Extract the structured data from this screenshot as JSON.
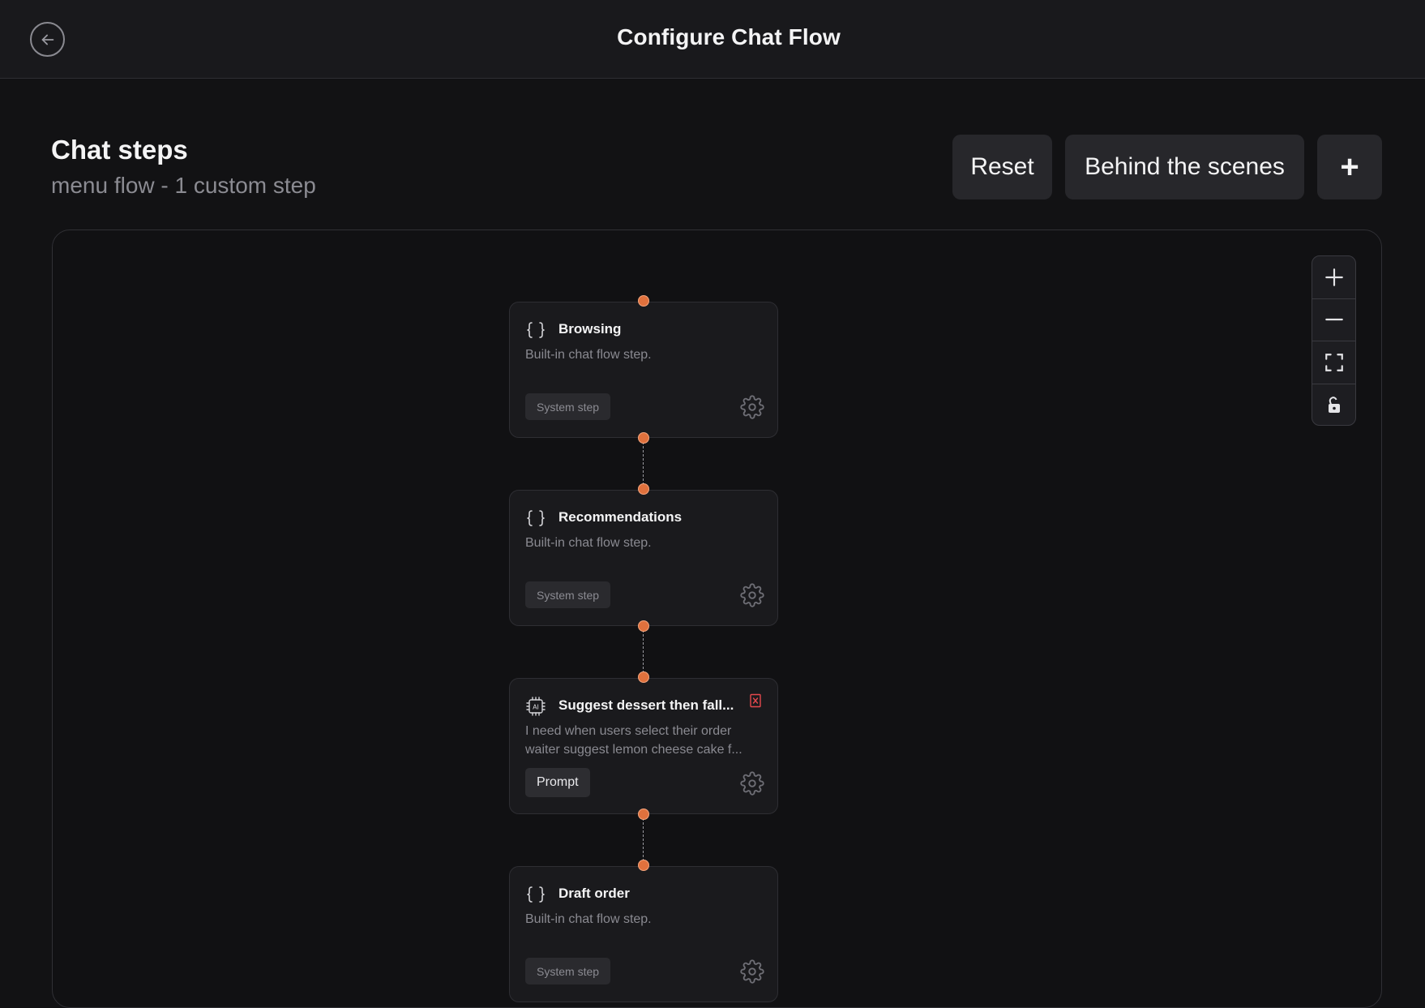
{
  "header": {
    "title": "Configure Chat Flow"
  },
  "section": {
    "title": "Chat steps",
    "subtitle": "menu flow - 1 custom step"
  },
  "actions": {
    "reset_label": "Reset",
    "behind_label": "Behind the scenes",
    "add_label": "+"
  },
  "nodes": [
    {
      "title": "Browsing",
      "description": "Built-in chat flow step.",
      "badge": "System step",
      "icon": "braces-icon"
    },
    {
      "title": "Recommendations",
      "description": "Built-in chat flow step.",
      "badge": "System step",
      "icon": "braces-icon"
    },
    {
      "title": "Suggest dessert then fall...",
      "description": "I need when users select their order waiter suggest lemon cheese cake f...",
      "badge": "Prompt",
      "icon": "ai-chip-icon"
    },
    {
      "title": "Draft order",
      "description": "Built-in chat flow step.",
      "badge": "System step",
      "icon": "braces-icon"
    }
  ],
  "controls": [
    "zoom-in-icon",
    "zoom-out-icon",
    "fit-view-icon",
    "lock-icon"
  ],
  "colors": {
    "accent": "#e0713d",
    "background": "#121214",
    "delete": "#e5484d"
  }
}
